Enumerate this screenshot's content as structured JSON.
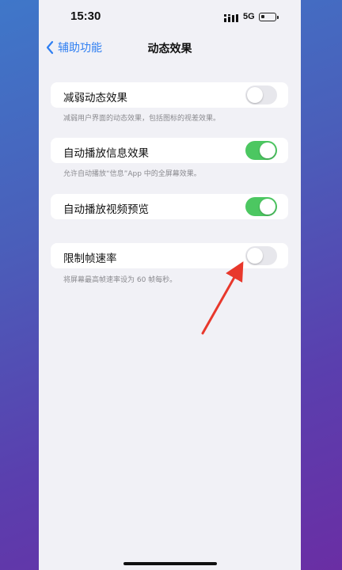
{
  "status_bar": {
    "time": "15:30",
    "network": "5G"
  },
  "nav": {
    "back_label": "辅助功能",
    "title": "动态效果"
  },
  "settings": {
    "reduce_motion": {
      "label": "减弱动态效果",
      "footer": "减弱用户界面的动态效果，包括图标的视差效果。",
      "enabled": false
    },
    "auto_play_message_effects": {
      "label": "自动播放信息效果",
      "footer": "允许自动播放“信息”App 中的全屏幕效果。",
      "enabled": true
    },
    "auto_play_video_previews": {
      "label": "自动播放视频预览",
      "enabled": true
    },
    "limit_frame_rate": {
      "label": "限制帧速率",
      "footer": "将屏幕最高帧速率设为 60 帧每秒。",
      "enabled": false
    }
  },
  "colors": {
    "accent_blue": "#2f7ff2",
    "toggle_on": "#4cc761",
    "toggle_off": "#e7e7ec",
    "annotation_arrow": "#e8382c"
  },
  "icons": {
    "back": "chevron-left-icon",
    "signal": "cellular-signal-icon",
    "battery": "battery-icon"
  }
}
